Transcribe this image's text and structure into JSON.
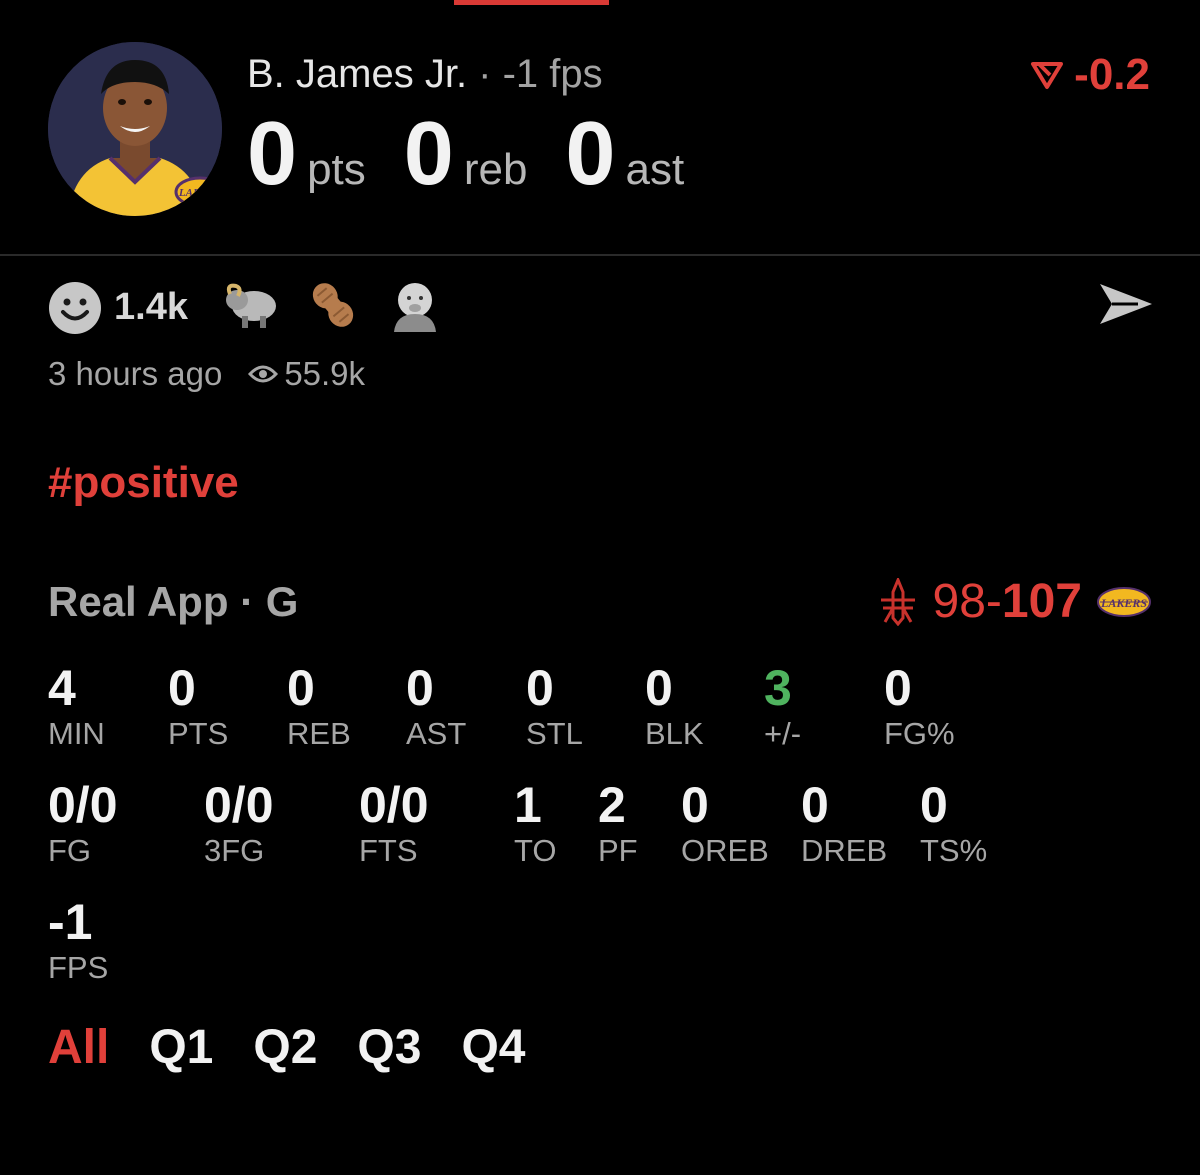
{
  "header": {
    "player_name": "B. James Jr.",
    "fps_text": " · -1 fps",
    "pts_value": "0",
    "pts_unit": "pts",
    "reb_value": "0",
    "reb_unit": "reb",
    "ast_value": "0",
    "ast_unit": "ast",
    "score_change": "-0.2",
    "score_change_icon": "down-triangle-icon",
    "accent_color": "#e0403a"
  },
  "post": {
    "reaction_count": "1.4k",
    "reactions": [
      "smiley-icon",
      "sheep-icon",
      "peanut-icon",
      "baby-icon"
    ],
    "time_ago": "3 hours ago",
    "views": "55.9k",
    "hashtag": "#positive"
  },
  "game": {
    "source": "Real App · G",
    "score_left": "98-",
    "score_right": "107",
    "home_logo": "rockets-logo",
    "away_logo": "lakers-logo"
  },
  "stats_row1": [
    {
      "value": "4",
      "label": "MIN"
    },
    {
      "value": "0",
      "label": "PTS"
    },
    {
      "value": "0",
      "label": "REB"
    },
    {
      "value": "0",
      "label": "AST"
    },
    {
      "value": "0",
      "label": "STL"
    },
    {
      "value": "0",
      "label": "BLK"
    },
    {
      "value": "3",
      "label": "+/-"
    },
    {
      "value": "0",
      "label": "FG%"
    }
  ],
  "stats_row2": [
    {
      "value": "0/0",
      "label": "FG"
    },
    {
      "value": "0/0",
      "label": "3FG"
    },
    {
      "value": "0/0",
      "label": "FTS"
    },
    {
      "value": "1",
      "label": "TO"
    },
    {
      "value": "2",
      "label": "PF"
    },
    {
      "value": "0",
      "label": "OREB"
    },
    {
      "value": "0",
      "label": "DREB"
    },
    {
      "value": "0",
      "label": "TS%"
    }
  ],
  "stats_row3": [
    {
      "value": "-1",
      "label": "FPS"
    }
  ],
  "quarters": [
    "All",
    "Q1",
    "Q2",
    "Q3",
    "Q4"
  ]
}
